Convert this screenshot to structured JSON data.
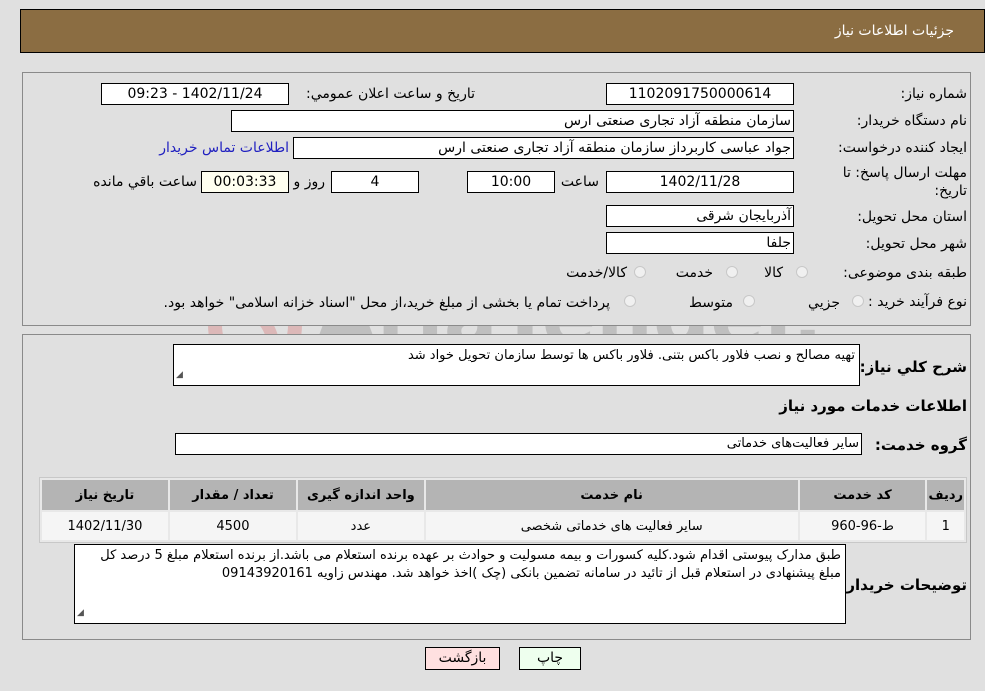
{
  "header": {
    "title": "جزئیات اطلاعات نیاز"
  },
  "fields": {
    "need_number": {
      "label": "شماره نیاز:",
      "value": "1102091750000614"
    },
    "announce_datetime": {
      "label": "تاریخ و ساعت اعلان عمومي:",
      "value": "1402/11/24 - 09:23"
    },
    "buyer_org": {
      "label": "نام دستگاه خريدار:",
      "value": "سازمان منطقه آزاد تجاری صنعتی ارس"
    },
    "requester": {
      "label": "ایجاد کننده درخواست:",
      "value": "جواد عباسی کاربرداز سازمان منطقه آزاد تجاری صنعتی ارس"
    },
    "buyer_contact_link": "اطلاعات تماس خریدار",
    "deadline": {
      "label_line1": "مهلت ارسال پاسخ: تا",
      "label_line2": "تاریخ:",
      "date": "1402/11/28",
      "time_label": "ساعت",
      "time": "10:00",
      "days": "4",
      "days_label": "روز و",
      "remaining": "00:03:33",
      "remaining_label": "ساعت باقي مانده"
    },
    "province": {
      "label": "استان محل تحویل:",
      "value": "آذربایجان شرقی"
    },
    "city": {
      "label": "شهر محل تحویل:",
      "value": "جلفا"
    },
    "category": {
      "label": "طبقه بندی موضوعی:",
      "options": [
        "کالا",
        "خدمت",
        "کالا/خدمت"
      ]
    },
    "purchase_type": {
      "label": "نوع فرآیند خرید :",
      "options": [
        "جزيي",
        "متوسط"
      ],
      "note_option": "پرداخت تمام یا بخشی از مبلغ خرید،از محل \"اسناد خزانه اسلامی\" خواهد بود."
    }
  },
  "description": {
    "label": "شرح کلي نياز:",
    "value": "تهیه مصالح و نصب فلاور باکس بتنی. فلاور باکس ها توسط سازمان تحویل خواد شد"
  },
  "services_section": {
    "title": "اطلاعات خدمات مورد نیاز",
    "group_label": "گروه خدمت:",
    "group_value": "سایر فعالیت‌های خدماتی"
  },
  "table": {
    "headers": [
      "ردیف",
      "کد خدمت",
      "نام خدمت",
      "واحد اندازه گیری",
      "تعداد / مقدار",
      "تاریخ نیاز"
    ],
    "rows": [
      [
        "1",
        "ط-96-960",
        "سایر فعالیت های خدماتی شخصی",
        "عدد",
        "4500",
        "1402/11/30"
      ]
    ]
  },
  "buyer_notes": {
    "label": "توضیحات خریدار:",
    "value": "طبق مدارک پیوستی اقدام شود.کلیه کسورات و بیمه مسولیت و حوادث بر عهده برنده استعلام می باشد.از برنده استعلام مبلغ 5 درصد کل مبلغ پیشنهادی در استعلام قبل از تائید در سامانه تضمین بانکی (چک )اخذ خواهد شد. مهندس زاویه 09143920161"
  },
  "buttons": {
    "print": "چاپ",
    "back": "بازگشت"
  },
  "watermark": {
    "text": "AriaTender.neT"
  },
  "colors": {
    "header_bg": "#8b6d42",
    "print_bg": "#eeffee",
    "back_bg": "#ffe0e0",
    "remaining_bg": "#fffff0",
    "link": "#2020c0"
  }
}
